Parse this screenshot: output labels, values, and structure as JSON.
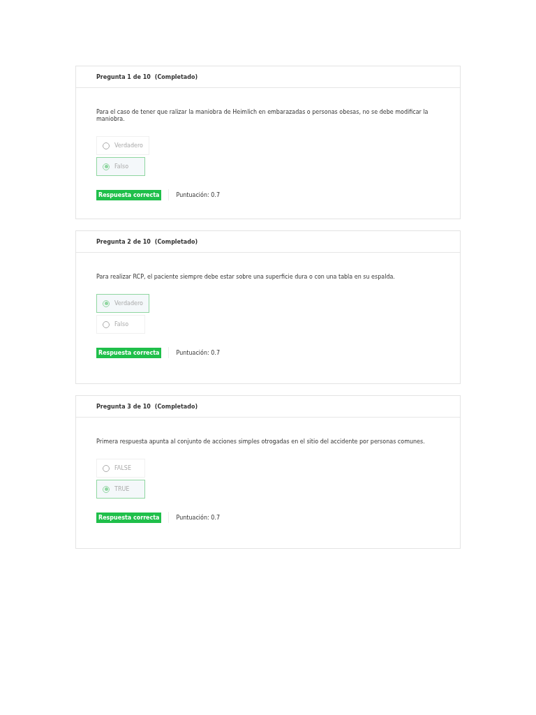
{
  "questions": [
    {
      "header": "Pregunta 1 de 10",
      "status": "(Completado)",
      "text": "Para el caso de tener que ralizar la maniobra de Heimlich en embarazadas o personas obesas, no se debe modificar la maniobra.",
      "options": [
        {
          "label": "Verdadero",
          "selected": false
        },
        {
          "label": "Falso",
          "selected": true
        }
      ],
      "result": "Respuesta correcta",
      "score": "Puntuación: 0.7"
    },
    {
      "header": "Pregunta 2 de 10",
      "status": "(Completado)",
      "text": "Para realizar RCP, el paciente siempre debe estar sobre una superficie dura o con una tabla en su espalda.",
      "options": [
        {
          "label": "Verdadero",
          "selected": true
        },
        {
          "label": "Falso",
          "selected": false
        }
      ],
      "result": "Respuesta correcta",
      "score": "Puntuación: 0.7"
    },
    {
      "header": "Pregunta 3 de 10",
      "status": "(Completado)",
      "text": "Primera respuesta apunta al conjunto de acciones simples otrogadas en el sitio del accidente por personas comunes.",
      "options": [
        {
          "label": "FALSE",
          "selected": false
        },
        {
          "label": "TRUE",
          "selected": true
        }
      ],
      "result": "Respuesta correcta",
      "score": "Puntuación: 0.7"
    }
  ]
}
